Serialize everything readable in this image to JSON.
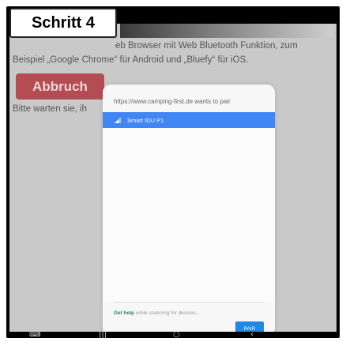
{
  "step_badge": "Schritt 4",
  "background": {
    "line1": "eb Browser mit Web Bluetooth Funktion, zum",
    "line2": "Beispiel „Google Chrome“ für Android und „Bluefy“ für iOS.",
    "abort_button": "Abbruch",
    "wait_text": "Bitte warten sie, ih"
  },
  "dialog": {
    "title": "https://www.camping-first.de wants to pair",
    "devices": [
      {
        "name": "Smart IDU P1",
        "selected": true
      }
    ],
    "footer_link": "Get help",
    "footer_text": " while scanning for devices...",
    "pair_button": "PAIR"
  },
  "colors": {
    "selection": "#4285f4",
    "pair_button": "#1e88e5",
    "abort_button": "#b3474d",
    "link": "#2e7d6f"
  },
  "navbar": {
    "icons": [
      "keyboard-icon",
      "recent-apps-icon",
      "home-icon",
      "back-icon"
    ]
  }
}
